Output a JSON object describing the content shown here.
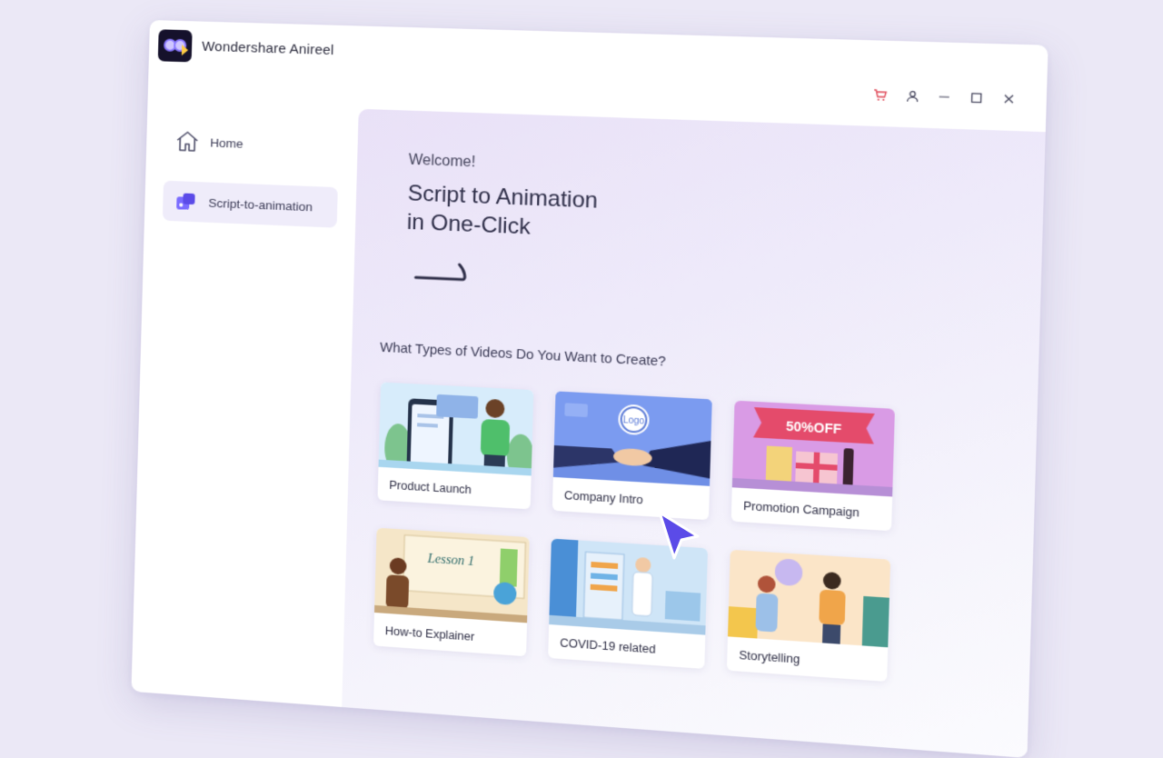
{
  "app": {
    "title": "Wondershare Anireel",
    "logo_icon": "anireel-logo-icon",
    "accent_color": "#6a5cff",
    "background_color": "#ebe8f6"
  },
  "window_controls": [
    {
      "name": "cart-icon",
      "color": "#e04b5a"
    },
    {
      "name": "account-icon"
    },
    {
      "name": "minimize-icon"
    },
    {
      "name": "maximize-icon"
    },
    {
      "name": "close-icon"
    }
  ],
  "sidebar": {
    "items": [
      {
        "label": "Home",
        "icon": "home-icon",
        "selected": false
      },
      {
        "label": "Script-to-animation",
        "icon": "script-animation-icon",
        "selected": true
      }
    ]
  },
  "main": {
    "welcome": "Welcome!",
    "headline_line1": "Script to Animation",
    "headline_line2": "in One-Click",
    "section_title": "What Types of Videos Do You Want to Create?",
    "video_types": [
      {
        "label": "Product Launch"
      },
      {
        "label": "Company Intro",
        "thumb_text": "Logo"
      },
      {
        "label": "Promotion Campaign",
        "thumb_text": "50%OFF"
      },
      {
        "label": "How-to Explainer",
        "thumb_text": "Lesson 1"
      },
      {
        "label": "COVID-19 related"
      },
      {
        "label": "Storytelling"
      }
    ]
  }
}
